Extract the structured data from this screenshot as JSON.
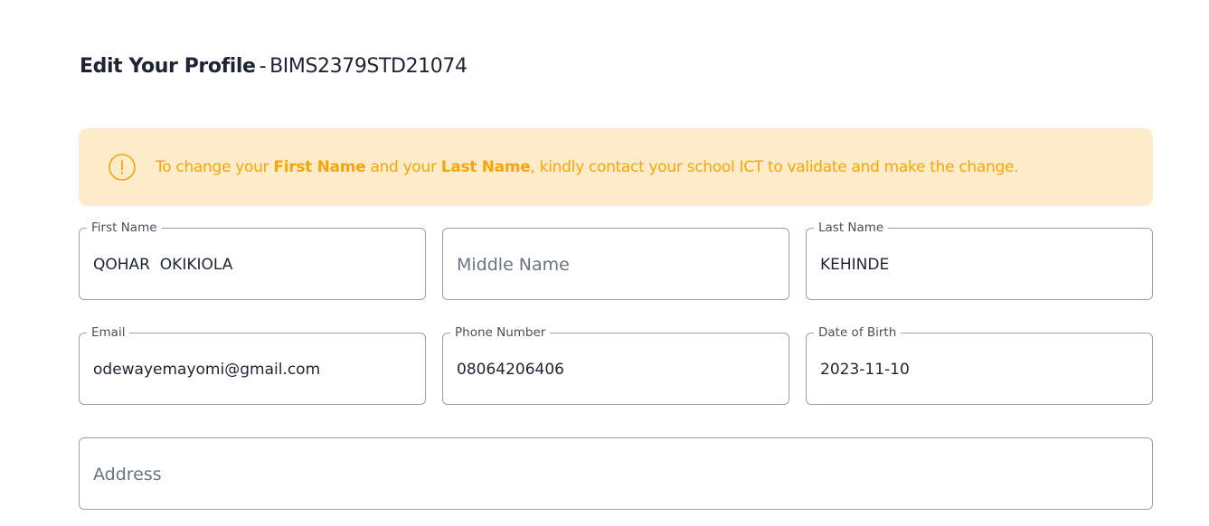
{
  "header": {
    "title_bold": "Edit Your Profile",
    "separator": "-",
    "student_id": "BIMS2379STD21074"
  },
  "alert": {
    "icon": "exclamation-circle-icon",
    "color": "#f4a60a",
    "background": "#fdebc9",
    "text_1": "To change your",
    "first_name_bold": "First Name",
    "text_2": "and your",
    "last_name_bold": "Last Name",
    "text_3": ", kindly contact your school ICT to validate and make the change."
  },
  "form": {
    "first_name": {
      "label": "First Name",
      "value": "QOHAR  OKIKIOLA"
    },
    "middle_name": {
      "placeholder": "Middle Name"
    },
    "last_name": {
      "label": "Last Name",
      "value": "KEHINDE"
    },
    "email": {
      "label": "Email",
      "value": "odewayemayomi@gmail.com"
    },
    "phone": {
      "label": "Phone Number",
      "value": "08064206406"
    },
    "dob": {
      "label": "Date of Birth",
      "value": "2023-11-10"
    },
    "address": {
      "placeholder": "Address"
    }
  }
}
